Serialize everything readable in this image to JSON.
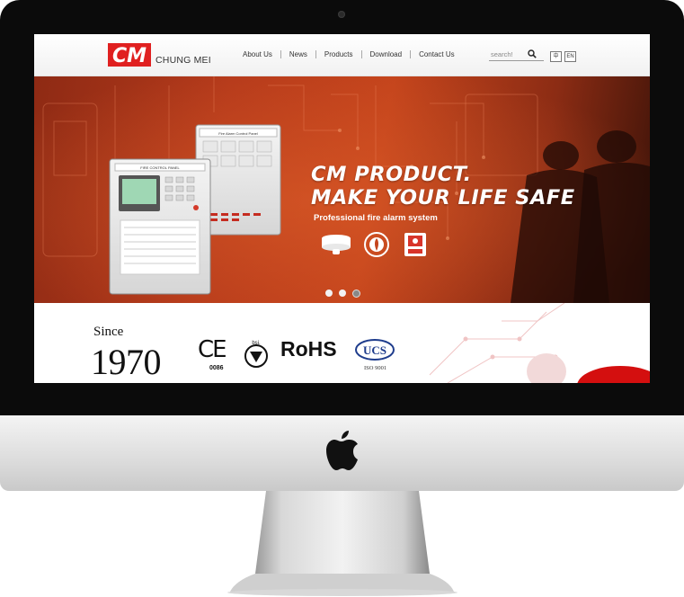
{
  "header": {
    "brand_mark": "CM",
    "brand_name": "CHUNG MEI",
    "nav": [
      "About Us",
      "News",
      "Products",
      "Download",
      "Contact Us"
    ],
    "search_placeholder": "search!",
    "lang_buttons": [
      "中",
      "EN"
    ]
  },
  "hero": {
    "title_line1": "CM PRODUCT.",
    "title_line2": "MAKE YOUR LIFE SAFE",
    "subtitle": "Professional fire alarm system",
    "panel_label_left": "FIRE CONTROL PANEL",
    "panel_label_right": "Fire Alarm Control Panel",
    "slider_total": 3,
    "slider_active": 3
  },
  "certifications": {
    "since_label": "Since",
    "year": "1970",
    "ce": "CE",
    "ce_code": "0086",
    "bsi": "bsi.",
    "rohs": "RoHS",
    "ucs": "UCS",
    "iso": "ISO 9001"
  },
  "colors": {
    "brand_red": "#e02020",
    "hero_red": "#c4441c"
  },
  "icons": [
    "search-icon",
    "apple-logo-icon",
    "smoke-detector-icon",
    "heat-detector-icon",
    "manual-call-point-icon",
    "bsi-kitemark-icon",
    "ucs-logo-icon"
  ]
}
